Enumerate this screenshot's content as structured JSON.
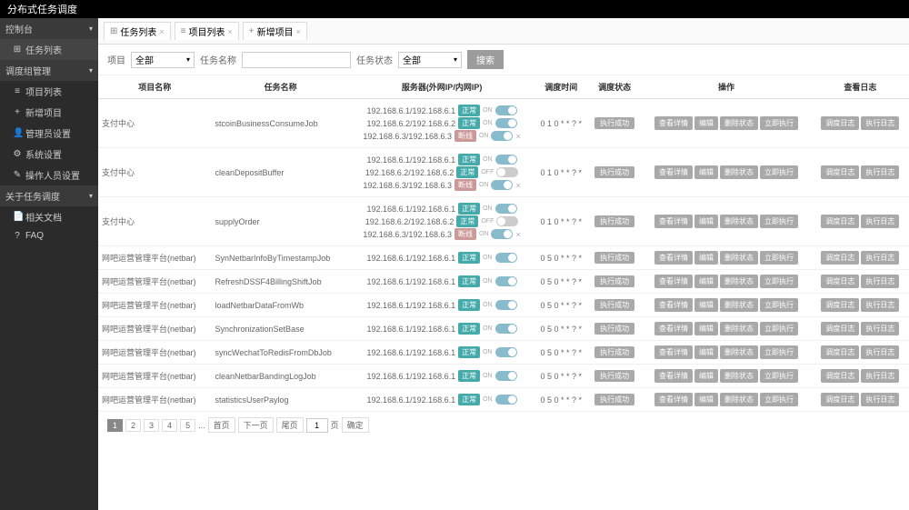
{
  "app_title": "分布式任务调度",
  "sidebar": {
    "groups": [
      {
        "header": "控制台",
        "items": [
          {
            "icon": "⊞",
            "label": "任务列表",
            "active": true
          }
        ]
      },
      {
        "header": "调度组管理",
        "items": [
          {
            "icon": "≡",
            "label": "项目列表"
          },
          {
            "icon": "+",
            "label": "新增项目"
          },
          {
            "icon": "👤",
            "label": "管理员设置"
          },
          {
            "icon": "⚙",
            "label": "系统设置"
          },
          {
            "icon": "✎",
            "label": "操作人员设置"
          }
        ]
      },
      {
        "header": "关于任务调度",
        "items": [
          {
            "icon": "📄",
            "label": "相关文档"
          },
          {
            "icon": "?",
            "label": "FAQ"
          }
        ]
      }
    ]
  },
  "tabs": [
    {
      "icon": "⊞",
      "label": "任务列表"
    },
    {
      "icon": "≡",
      "label": "项目列表"
    },
    {
      "icon": "+",
      "label": "新增项目"
    }
  ],
  "filters": {
    "project_label": "项目",
    "project_value": "全部",
    "taskname_label": "任务名称",
    "status_label": "任务状态",
    "status_value": "全部",
    "search_btn": "搜索"
  },
  "columns": [
    "项目名称",
    "任务名称",
    "服务器(外网IP/内网IP)",
    "调度时间",
    "调度状态",
    "操作",
    "查看日志"
  ],
  "status_text": "执行成功",
  "op_buttons": [
    "查看详情",
    "编辑",
    "删除状态",
    "立即执行"
  ],
  "log_buttons": [
    "调度日志",
    "执行日志"
  ],
  "rows": [
    {
      "project": "支付中心",
      "task": "stcoinBusinessConsumeJob",
      "servers": [
        {
          "ip": "192.168.6.1/192.168.6.1",
          "badge": "正常",
          "badge_cls": "badge-ok",
          "on": true,
          "close": false
        },
        {
          "ip": "192.168.6.2/192.168.6.2",
          "badge": "正常",
          "badge_cls": "badge-ok",
          "on": true,
          "close": false
        },
        {
          "ip": "192.168.6.3/192.168.6.3",
          "badge": "断线",
          "badge_cls": "badge-warn",
          "on": true,
          "close": true
        }
      ],
      "cron": "0 1 0 * * ? *"
    },
    {
      "project": "支付中心",
      "task": "cleanDepositBuffer",
      "servers": [
        {
          "ip": "192.168.6.1/192.168.6.1",
          "badge": "正常",
          "badge_cls": "badge-ok",
          "on": true,
          "close": false
        },
        {
          "ip": "192.168.6.2/192.168.6.2",
          "badge": "正常",
          "badge_cls": "badge-ok",
          "on": false,
          "close": false
        },
        {
          "ip": "192.168.6.3/192.168.6.3",
          "badge": "断线",
          "badge_cls": "badge-warn",
          "on": true,
          "close": true
        }
      ],
      "cron": "0 1 0 * * ? *"
    },
    {
      "project": "支付中心",
      "task": "supplyOrder",
      "servers": [
        {
          "ip": "192.168.6.1/192.168.6.1",
          "badge": "正常",
          "badge_cls": "badge-ok",
          "on": true,
          "close": false
        },
        {
          "ip": "192.168.6.2/192.168.6.2",
          "badge": "正常",
          "badge_cls": "badge-ok",
          "on": false,
          "close": false
        },
        {
          "ip": "192.168.6.3/192.168.6.3",
          "badge": "断线",
          "badge_cls": "badge-warn",
          "on": true,
          "close": true
        }
      ],
      "cron": "0 1 0 * * ? *"
    },
    {
      "project": "网吧运营管理平台(netbar)",
      "task": "SynNetbarInfoByTimestampJob",
      "servers": [
        {
          "ip": "192.168.6.1/192.168.6.1",
          "badge": "正常",
          "badge_cls": "badge-ok",
          "on": true,
          "close": false
        }
      ],
      "cron": "0 5 0 * * ? *"
    },
    {
      "project": "网吧运营管理平台(netbar)",
      "task": "RefreshDSSF4BillingShiftJob",
      "servers": [
        {
          "ip": "192.168.6.1/192.168.6.1",
          "badge": "正常",
          "badge_cls": "badge-ok",
          "on": true,
          "close": false
        }
      ],
      "cron": "0 5 0 * * ? *"
    },
    {
      "project": "网吧运营管理平台(netbar)",
      "task": "loadNetbarDataFromWb",
      "servers": [
        {
          "ip": "192.168.6.1/192.168.6.1",
          "badge": "正常",
          "badge_cls": "badge-ok",
          "on": true,
          "close": false
        }
      ],
      "cron": "0 5 0 * * ? *"
    },
    {
      "project": "网吧运营管理平台(netbar)",
      "task": "SynchronizationSetBase",
      "servers": [
        {
          "ip": "192.168.6.1/192.168.6.1",
          "badge": "正常",
          "badge_cls": "badge-ok",
          "on": true,
          "close": false
        }
      ],
      "cron": "0 5 0 * * ? *"
    },
    {
      "project": "网吧运营管理平台(netbar)",
      "task": "syncWechatToRedisFromDbJob",
      "servers": [
        {
          "ip": "192.168.6.1/192.168.6.1",
          "badge": "正常",
          "badge_cls": "badge-ok",
          "on": true,
          "close": false
        }
      ],
      "cron": "0 5 0 * * ? *"
    },
    {
      "project": "网吧运营管理平台(netbar)",
      "task": "cleanNetbarBandingLogJob",
      "servers": [
        {
          "ip": "192.168.6.1/192.168.6.1",
          "badge": "正常",
          "badge_cls": "badge-ok",
          "on": true,
          "close": false
        }
      ],
      "cron": "0 5 0 * * ? *"
    },
    {
      "project": "网吧运营管理平台(netbar)",
      "task": "statisticsUserPaylog",
      "servers": [
        {
          "ip": "192.168.6.1/192.168.6.1",
          "badge": "正常",
          "badge_cls": "badge-ok",
          "on": true,
          "close": false
        }
      ],
      "cron": "0 5 0 * * ? *"
    }
  ],
  "pager": {
    "pages": [
      "1",
      "2",
      "3",
      "4",
      "5"
    ],
    "ellipsis": "...",
    "first": "首页",
    "next": "下一页",
    "last": "尾页",
    "goto_value": "1",
    "unit": "页",
    "confirm": "确定"
  }
}
